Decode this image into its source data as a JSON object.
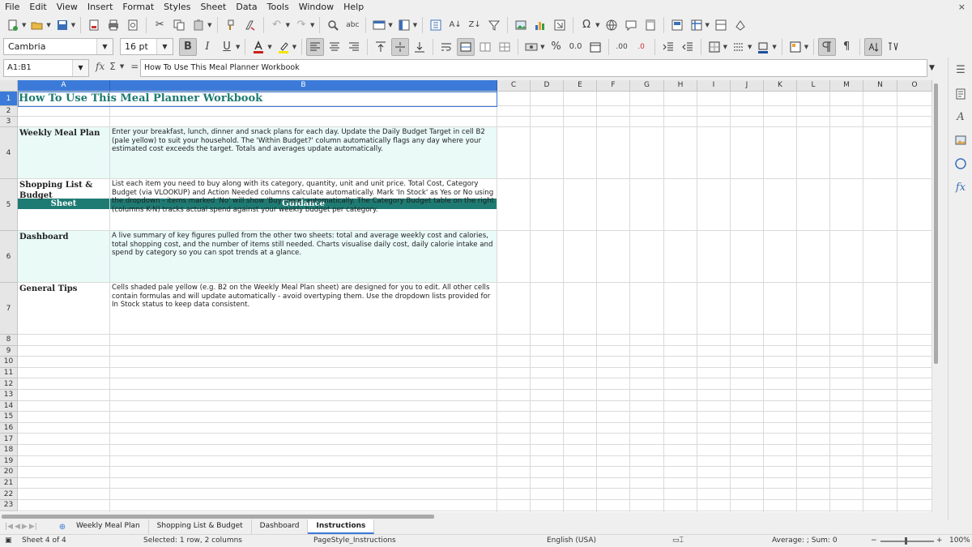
{
  "menubar": {
    "items": [
      "File",
      "Edit",
      "View",
      "Insert",
      "Format",
      "Styles",
      "Sheet",
      "Data",
      "Tools",
      "Window",
      "Help"
    ],
    "close_glyph": "×"
  },
  "toolbar2": {
    "font_name": "Cambria",
    "font_size": "16 pt",
    "bold": "B",
    "italic": "I",
    "underline": "U",
    "percent": "%",
    "number_format": "0.0",
    "add_decimal": ".00",
    "remove_decimal": ".0"
  },
  "formula_bar": {
    "name_box": "A1:B1",
    "content": "How To Use This Meal Planner Workbook"
  },
  "columns": [
    {
      "label": "A"
    },
    {
      "label": "B"
    },
    {
      "label": "C"
    },
    {
      "label": "D"
    },
    {
      "label": "E"
    },
    {
      "label": "F"
    },
    {
      "label": "G"
    },
    {
      "label": "H"
    },
    {
      "label": "I"
    },
    {
      "label": "J"
    },
    {
      "label": "K"
    },
    {
      "label": "L"
    },
    {
      "label": "M"
    },
    {
      "label": "N"
    },
    {
      "label": "O"
    }
  ],
  "rows": [
    "1",
    "2",
    "3",
    "4",
    "5",
    "6",
    "7",
    "8",
    "9",
    "10",
    "11",
    "12",
    "13",
    "14",
    "15",
    "16",
    "17",
    "18",
    "19",
    "20",
    "21",
    "22",
    "23"
  ],
  "sheet": {
    "title": "How To Use This Meal Planner Workbook",
    "header_sheet": "Sheet",
    "header_guidance": "Guidance",
    "entries": [
      {
        "sheet": "Weekly Meal Plan",
        "guidance": "Enter your breakfast, lunch, dinner and snack plans for each day. Update the Daily Budget Target in cell B2 (pale yellow) to suit your household. The 'Within Budget?' column automatically flags any day where your estimated cost exceeds the target. Totals and averages update automatically."
      },
      {
        "sheet": "Shopping List & Budget",
        "guidance": "List each item you need to buy along with its category, quantity, unit and unit price. Total Cost, Category Budget (via VLOOKUP) and Action Needed columns calculate automatically. Mark 'In Stock' as Yes or No using the dropdown - items marked 'No' will show 'Buy more' automatically. The Category Budget table on the right (columns K-N) tracks actual spend against your weekly budget per category."
      },
      {
        "sheet": "Dashboard",
        "guidance": "A live summary of key figures pulled from the other two sheets: total and average weekly cost and calories, total shopping cost, and the number of items still needed. Charts visualise daily cost, daily calorie intake and spend by category so you can spot trends at a glance."
      },
      {
        "sheet": "General Tips",
        "guidance": "Cells shaded pale yellow (e.g. B2 on the Weekly Meal Plan sheet) are designed for you to edit. All other cells contain formulas and will update automatically - avoid overtyping them. Use the dropdown lists provided for In Stock status to keep data consistent."
      }
    ]
  },
  "tabs": [
    {
      "label": "Weekly Meal Plan",
      "active": false
    },
    {
      "label": "Shopping List & Budget",
      "active": false
    },
    {
      "label": "Dashboard",
      "active": false
    },
    {
      "label": "Instructions",
      "active": true
    }
  ],
  "statusbar": {
    "sheet_pos": "Sheet 4 of 4",
    "selection": "Selected: 1 row, 2 columns",
    "page_style": "PageStyle_Instructions",
    "language": "English (USA)",
    "summary": "Average: ; Sum: 0",
    "zoom": "100%"
  },
  "colors": {
    "accent_teal": "#1e7b73",
    "tint": "#e9faf7",
    "selection_blue": "#3b7ad8"
  }
}
